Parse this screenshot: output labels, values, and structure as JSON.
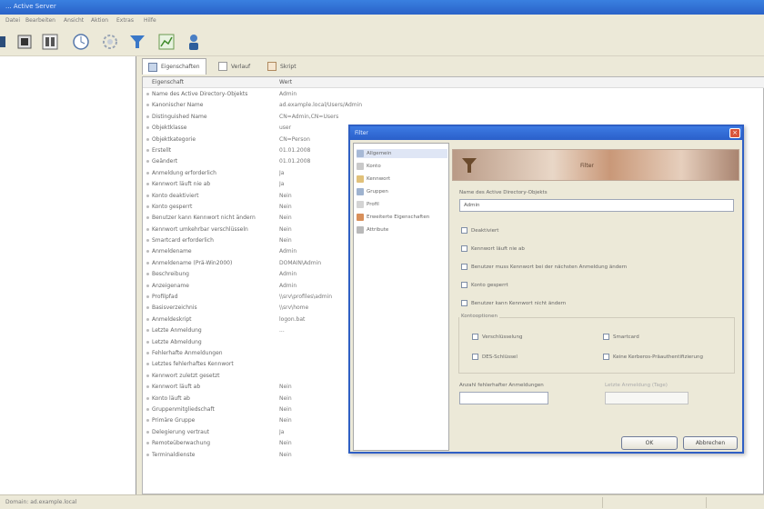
{
  "window": {
    "title": "... Active Server"
  },
  "menu": [
    {
      "label": "Datei"
    },
    {
      "label": "Bearbeiten"
    },
    {
      "label": "Ansicht"
    },
    {
      "label": "Aktion"
    },
    {
      "label": "Extras"
    },
    {
      "label": "Hilfe"
    }
  ],
  "toolbar": {
    "icons": [
      "arrow-icon",
      "stop-icon",
      "grid-icon",
      "refresh-icon",
      "settings-icon",
      "filter-icon",
      "chart-icon",
      "user-icon"
    ]
  },
  "tabs": [
    {
      "label": "Eigenschaften",
      "active": true
    },
    {
      "label": "Verlauf",
      "active": false
    },
    {
      "label": "Skript",
      "active": false
    }
  ],
  "grid": {
    "columns": [
      "Eigenschaft",
      "Wert"
    ],
    "rows": [
      {
        "key": "Name des Active Directory-Objekts",
        "value": "Admin"
      },
      {
        "key": "Kanonischer Name",
        "value": "ad.example.local/Users/Admin"
      },
      {
        "key": "Distinguished Name",
        "value": "CN=Admin,CN=Users"
      },
      {
        "key": "Objektklasse",
        "value": "user"
      },
      {
        "key": "Objektkategorie",
        "value": "CN=Person"
      },
      {
        "key": "Erstellt",
        "value": "01.01.2008"
      },
      {
        "key": "Geändert",
        "value": "01.01.2008"
      },
      {
        "key": "Anmeldung erforderlich",
        "value": "Ja"
      },
      {
        "key": "Kennwort läuft nie ab",
        "value": "Ja"
      },
      {
        "key": "Konto deaktiviert",
        "value": "Nein"
      },
      {
        "key": "Konto gesperrt",
        "value": "Nein"
      },
      {
        "key": "Benutzer kann Kennwort nicht ändern",
        "value": "Nein"
      },
      {
        "key": "Kennwort umkehrbar verschlüsseln",
        "value": "Nein"
      },
      {
        "key": "Smartcard erforderlich",
        "value": "Nein"
      },
      {
        "key": "Anmeldename",
        "value": "Admin"
      },
      {
        "key": "Anmeldename (Prä-Win2000)",
        "value": "DOMAIN\\Admin"
      },
      {
        "key": "Beschreibung",
        "value": "Admin"
      },
      {
        "key": "Anzeigename",
        "value": "Admin"
      },
      {
        "key": "Profilpfad",
        "value": "\\\\srv\\profiles\\admin"
      },
      {
        "key": "Basisverzeichnis",
        "value": "\\\\srv\\home"
      },
      {
        "key": "Anmeldeskript",
        "value": "logon.bat"
      },
      {
        "key": "Letzte Anmeldung",
        "value": "..."
      },
      {
        "key": "Letzte Abmeldung",
        "value": ""
      },
      {
        "key": "Fehlerhafte Anmeldungen",
        "value": ""
      },
      {
        "key": "Letztes fehlerhaftes Kennwort",
        "value": ""
      },
      {
        "key": "Kennwort zuletzt gesetzt",
        "value": ""
      },
      {
        "key": "Kennwort läuft ab",
        "value": "Nein"
      },
      {
        "key": "Konto läuft ab",
        "value": "Nein"
      },
      {
        "key": "Gruppenmitgliedschaft",
        "value": "Nein"
      },
      {
        "key": "Primäre Gruppe",
        "value": "Nein"
      },
      {
        "key": "Delegierung vertraut",
        "value": "Ja"
      },
      {
        "key": "Remoteüberwachung",
        "value": "Nein"
      },
      {
        "key": "Terminaldienste",
        "value": "Nein"
      }
    ]
  },
  "status": {
    "text": "Domain: ad.example.local"
  },
  "dialog": {
    "title": "Filter",
    "close": "×",
    "nav": [
      {
        "label": "Allgemein",
        "selected": true
      },
      {
        "label": "Konto"
      },
      {
        "label": "Kennwort"
      },
      {
        "label": "Gruppen"
      },
      {
        "label": "Profil"
      },
      {
        "label": "Erweiterte Eigenschaften"
      },
      {
        "label": "Attribute"
      }
    ],
    "banner": "Filter",
    "name_label": "Name des Active Directory-Objekts",
    "name_value": "Admin",
    "checkboxes": [
      {
        "label": "Deaktiviert"
      },
      {
        "label": "Kennwort läuft nie ab"
      },
      {
        "label": "Benutzer muss Kennwort bei der nächsten Anmeldung ändern"
      },
      {
        "label": "Konto gesperrt"
      },
      {
        "label": "Benutzer kann Kennwort nicht ändern"
      }
    ],
    "group": {
      "title": "Kontooptionen",
      "options": [
        {
          "label": "Verschlüsselung"
        },
        {
          "label": "Smartcard"
        },
        {
          "label": "DES-Schlüssel"
        },
        {
          "label": "Keine Kerberos-Präauthentifizierung"
        }
      ]
    },
    "field2_label": "Anzahl fehlerhafter Anmeldungen",
    "field3_label": "Letzte Anmeldung (Tage)",
    "ok": "OK",
    "cancel": "Abbrechen"
  }
}
